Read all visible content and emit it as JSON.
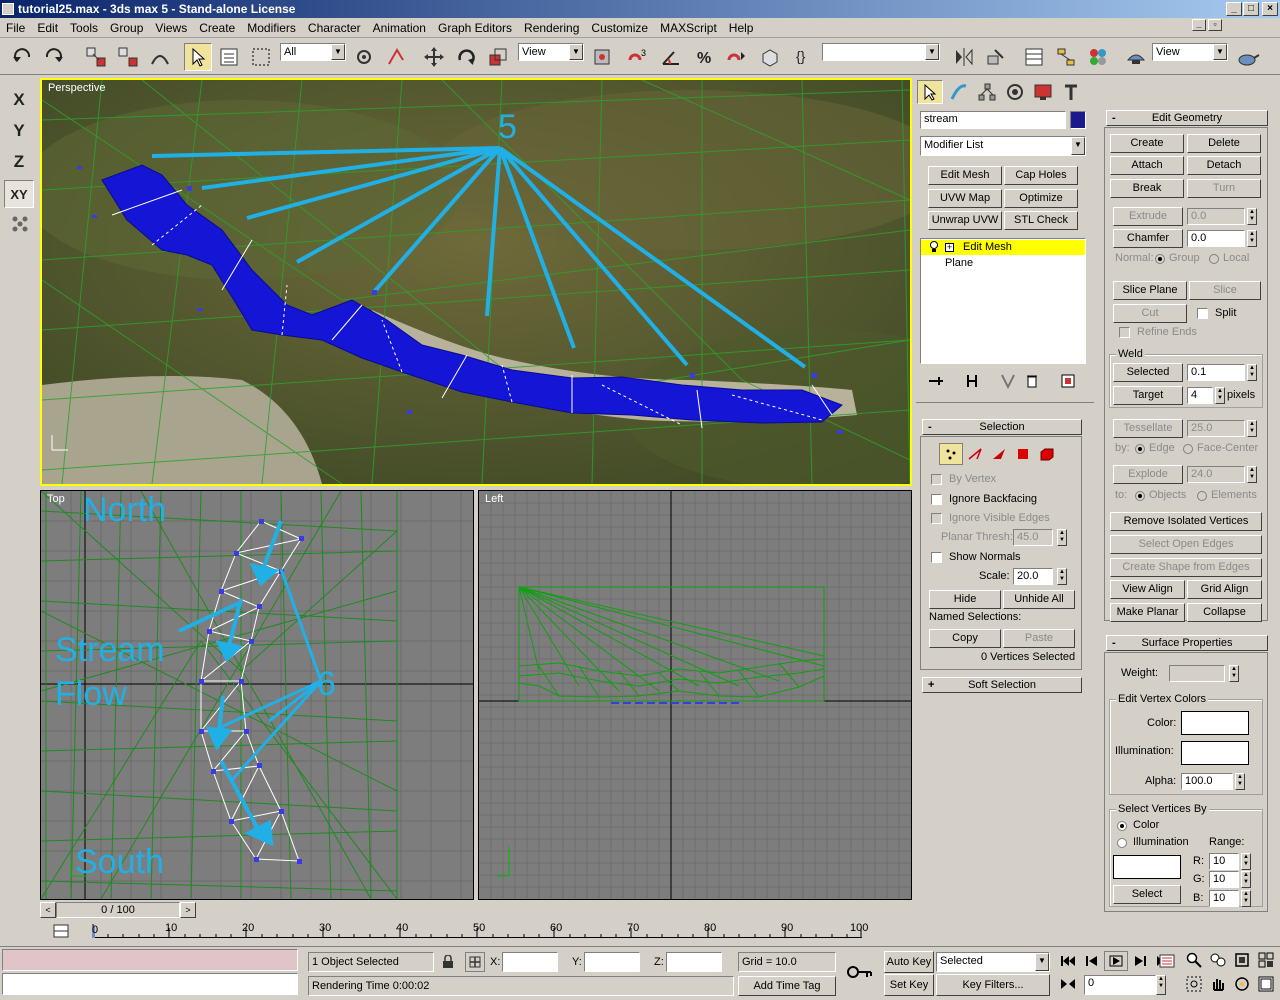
{
  "window": {
    "title": "tutorial25.max - 3ds max 5 - Stand-alone License",
    "buttons": [
      "_",
      "□",
      "×"
    ],
    "mdi_buttons": [
      "_",
      "▫",
      "×"
    ]
  },
  "menu": [
    "File",
    "Edit",
    "Tools",
    "Group",
    "Views",
    "Create",
    "Modifiers",
    "Character",
    "Animation",
    "Graph Editors",
    "Rendering",
    "Customize",
    "MAXScript",
    "Help"
  ],
  "toolbar": {
    "selection_filter": "All",
    "ref_coord": "View",
    "named_selection": "",
    "render_view": "View"
  },
  "axis_buttons": [
    "X",
    "Y",
    "Z",
    "XY"
  ],
  "viewports": {
    "perspective": {
      "label": "Perspective",
      "annotation": "5"
    },
    "top": {
      "label": "Top",
      "annotations": [
        "North",
        "Stream",
        "Flow",
        "6",
        "South"
      ]
    },
    "left": {
      "label": "Left"
    }
  },
  "command_panel": {
    "object_name": "stream",
    "object_color": "#1a1a8c",
    "modifier_list": "Modifier List",
    "modifier_buttons": [
      "Edit Mesh",
      "Cap Holes",
      "UVW Map",
      "Optimize",
      "Unwrap UVW",
      "STL Check"
    ],
    "stack": [
      "Edit Mesh",
      "Plane"
    ],
    "stack_icons": [
      "bulb-icon",
      "plus-box-icon"
    ],
    "selection_rollout": {
      "title": "Selection",
      "by_vertex": "By Vertex",
      "ignore_backfacing": "Ignore Backfacing",
      "ignore_visible_edges": "Ignore Visible Edges",
      "planar_thresh_label": "Planar Thresh:",
      "planar_thresh": "45.0",
      "show_normals": "Show Normals",
      "scale_label": "Scale:",
      "scale": "20.0",
      "hide": "Hide",
      "unhide_all": "Unhide All",
      "named_selections": "Named Selections:",
      "copy": "Copy",
      "paste": "Paste",
      "status": "0 Vertices Selected"
    },
    "soft_selection": {
      "title": "Soft Selection"
    }
  },
  "edit_geometry": {
    "title": "Edit Geometry",
    "create": "Create",
    "delete": "Delete",
    "attach": "Attach",
    "detach": "Detach",
    "break": "Break",
    "turn": "Turn",
    "extrude": "Extrude",
    "extrude_val": "0.0",
    "chamfer": "Chamfer",
    "chamfer_val": "0.0",
    "normal": "Normal:",
    "group": "Group",
    "local": "Local",
    "slice_plane": "Slice Plane",
    "slice": "Slice",
    "cut": "Cut",
    "split": "Split",
    "refine_ends": "Refine Ends",
    "weld": "Weld",
    "selected": "Selected",
    "selected_val": "0.1",
    "target": "Target",
    "target_val": "4",
    "pixels": "pixels",
    "tessellate": "Tessellate",
    "tessellate_val": "25.0",
    "by": "by:",
    "edge": "Edge",
    "face_center": "Face-Center",
    "explode": "Explode",
    "explode_val": "24.0",
    "to": "to:",
    "objects": "Objects",
    "elements": "Elements",
    "remove_isolated": "Remove Isolated Vertices",
    "select_open_edges": "Select Open Edges",
    "create_shape": "Create Shape from Edges",
    "view_align": "View Align",
    "grid_align": "Grid Align",
    "make_planar": "Make Planar",
    "collapse": "Collapse"
  },
  "surface_properties": {
    "title": "Surface Properties",
    "weight": "Weight:",
    "edit_vertex_colors": "Edit Vertex Colors",
    "color": "Color:",
    "illumination": "Illumination:",
    "alpha": "Alpha:",
    "alpha_val": "100.0",
    "select_by": "Select Vertices By",
    "by_color": "Color",
    "by_illum": "Illumination",
    "range": "Range:",
    "r": "R:",
    "g": "G:",
    "b": "B:",
    "r_val": "10",
    "g_val": "10",
    "b_val": "10",
    "select": "Select"
  },
  "timeline": {
    "slider": "0 / 100",
    "ticks": [
      "0",
      "10",
      "20",
      "30",
      "40",
      "50",
      "60",
      "70",
      "80",
      "90",
      "100"
    ]
  },
  "status": {
    "selection": "1 Object Selected",
    "x_label": "X:",
    "y_label": "Y:",
    "z_label": "Z:",
    "grid": "Grid = 10.0",
    "rendering_time": "Rendering Time  0:00:02",
    "add_time_tag": "Add Time Tag",
    "auto_key": "Auto Key",
    "set_key": "Set Key",
    "key_mode": "Selected",
    "key_filters": "Key Filters...",
    "frame": "0"
  }
}
